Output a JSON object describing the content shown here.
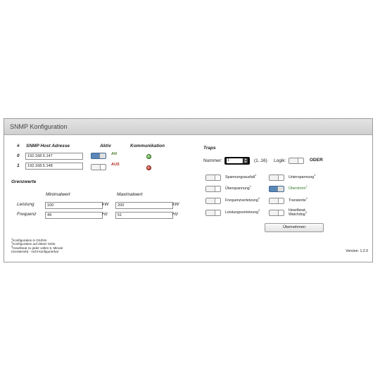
{
  "window": {
    "title": "SNMP Konfiguration"
  },
  "hosts": {
    "col_num": "#",
    "col_address": "SNMP Host Adresse",
    "col_active": "Aktiv",
    "col_comm": "Kommunikation",
    "rows": [
      {
        "index": "0",
        "address": "192.168.5.147",
        "active": true,
        "state": "AN",
        "comm": "green"
      },
      {
        "index": "1",
        "address": "192.168.5.148",
        "active": false,
        "state": "AUS",
        "comm": "red"
      }
    ]
  },
  "limits": {
    "title": "Grenzwerte",
    "col_min": "Minimalwert",
    "col_max": "Maximalwert",
    "rows": [
      {
        "label": "Leistung",
        "min": "100",
        "max": "200",
        "unit": "kW"
      },
      {
        "label": "Frequenz",
        "min": "49",
        "max": "51",
        "unit": "Hz"
      }
    ]
  },
  "traps": {
    "title": "Traps",
    "number_label": "Nummer:",
    "number_value": "1",
    "range": "(1..16)",
    "logic_label": "Logik:",
    "logic_value": "ODER",
    "items": [
      {
        "label": "Spannungsausfall",
        "sup": "1",
        "on": false,
        "green": false
      },
      {
        "label": "Unterspannung",
        "sup": "1",
        "on": false,
        "green": false
      },
      {
        "label": "Überspannung",
        "sup": "1",
        "on": false,
        "green": false
      },
      {
        "label": "Überstrom",
        "sup": "1",
        "on": true,
        "green": true
      },
      {
        "label": "Frequenzverletzung",
        "sup": "2",
        "on": false,
        "green": false
      },
      {
        "label": "Transiente",
        "sup": "1",
        "on": false,
        "green": false
      },
      {
        "label": "Leistungsverletzung",
        "sup": "2",
        "on": false,
        "green": false
      },
      {
        "label": "Heartbeat-Watchdog",
        "sup": "3",
        "on": false,
        "green": false
      }
    ],
    "apply_label": "Übernehmen"
  },
  "footnotes": [
    {
      "sup": "1",
      "text": "Konfiguration in GridVis"
    },
    {
      "sup": "2",
      "text": "Konfiguration auf dieser Seite"
    },
    {
      "sup": "3",
      "text": "Heartbeat zu jeder vollen 5. Minute"
    },
    {
      "sup": "",
      "text": "(Gerätezeit) - nicht konfigurierbar"
    }
  ],
  "version": "Version: 1.2.0",
  "colors": {
    "toggle_on": "#5a86b8",
    "led_ok": "#3d8a2a",
    "led_fail": "#a3271a",
    "state_on": "#4a7f2c",
    "state_off": "#b0261a"
  }
}
